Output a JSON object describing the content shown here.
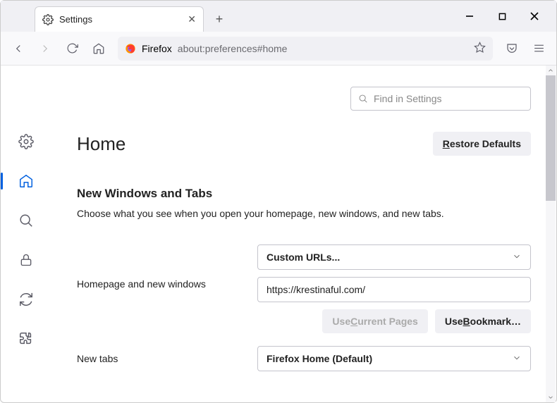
{
  "tab": {
    "title": "Settings"
  },
  "urlbar": {
    "identity": "Firefox",
    "url": "about:preferences#home"
  },
  "search": {
    "placeholder": "Find in Settings"
  },
  "page": {
    "title": "Home",
    "restore_label": "Restore Defaults",
    "restore_accesskey": "R"
  },
  "section": {
    "title": "New Windows and Tabs",
    "desc": "Choose what you see when you open your homepage, new windows, and new tabs."
  },
  "homepage": {
    "label": "Homepage and new windows",
    "mode": "Custom URLs...",
    "url_value": "https://krestinaful.com/",
    "use_current": "Use Current Pages",
    "use_current_accesskey": "C",
    "use_bookmark": "Use Bookmark…",
    "use_bookmark_accesskey": "B"
  },
  "newtabs": {
    "label": "New tabs",
    "mode": "Firefox Home (Default)"
  }
}
